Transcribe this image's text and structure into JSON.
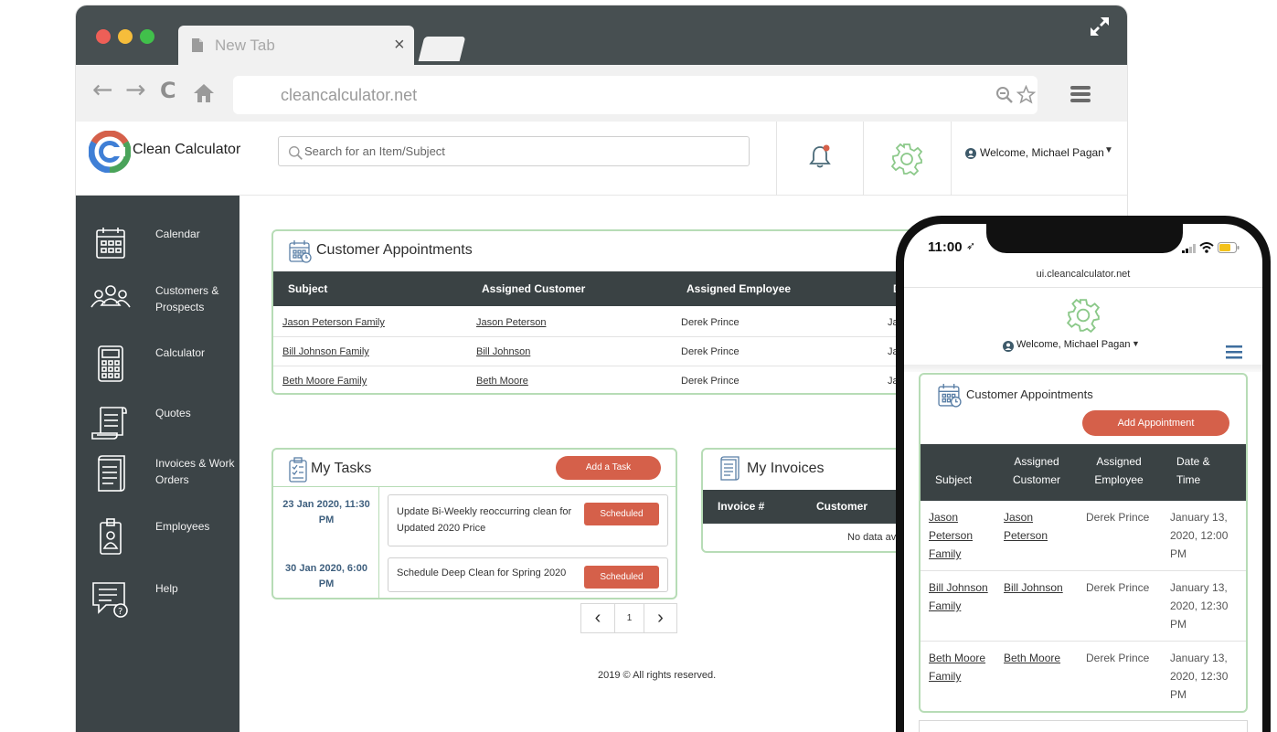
{
  "browser": {
    "tab_title": "New Tab",
    "tab_close": "×",
    "url": "cleancalculator.net"
  },
  "app": {
    "logo_text": "Clean Calculator",
    "search_placeholder": "Search for an Item/Subject",
    "welcome": "Welcome, Michael Pagan",
    "accent_color": "#d5604a",
    "dark_color": "#3c4447",
    "border_color": "#b7dcb6"
  },
  "sidebar": {
    "items": [
      {
        "label": "Calendar",
        "icon": "calendar-icon"
      },
      {
        "label": "Customers & Prospects",
        "icon": "customers-icon"
      },
      {
        "label": "Calculator",
        "icon": "calculator-icon"
      },
      {
        "label": "Quotes",
        "icon": "quotes-icon"
      },
      {
        "label": "Invoices & Work Orders",
        "icon": "invoices-icon"
      },
      {
        "label": "Employees",
        "icon": "employees-icon"
      },
      {
        "label": "Help",
        "icon": "help-icon"
      }
    ]
  },
  "appointments": {
    "title": "Customer Appointments",
    "columns": [
      "Subject",
      "Assigned Customer",
      "Assigned Employee",
      "D"
    ],
    "rows": [
      {
        "subject": "Jason Peterson Family",
        "customer": "Jason Peterson",
        "employee": "Derek Prince",
        "date": "Ja"
      },
      {
        "subject": "Bill Johnson Family",
        "customer": "Bill Johnson",
        "employee": "Derek Prince",
        "date": "Ja"
      },
      {
        "subject": "Beth Moore Family",
        "customer": "Beth Moore",
        "employee": "Derek Prince",
        "date": "Ja"
      }
    ]
  },
  "tasks": {
    "title": "My Tasks",
    "add_label": "Add a Task",
    "items": [
      {
        "date": "23 Jan 2020, 11:30 PM",
        "text": "Update Bi-Weekly reoccurring clean for Updated 2020 Price",
        "status": "Scheduled"
      },
      {
        "date": "30 Jan 2020, 6:00 PM",
        "text": "Schedule Deep Clean for Spring 2020",
        "status": "Scheduled"
      }
    ],
    "pager": {
      "prev": "‹",
      "page": "1",
      "next": "›"
    }
  },
  "invoices": {
    "title": "My Invoices",
    "columns": [
      "Invoice #",
      "Customer"
    ],
    "empty": "No data av"
  },
  "footer": "2019 © All rights reserved.",
  "phone": {
    "time": "11:00",
    "url": "ui.cleancalculator.net",
    "welcome": "Welcome, Michael Pagan",
    "card_title": "Customer Appointments",
    "add_label": "Add Appointment",
    "columns": [
      "Subject",
      "Assigned Customer",
      "Assigned Employee",
      "Date & Time"
    ],
    "rows": [
      {
        "subject": "Jason Peterson Family",
        "customer": "Jason Peterson",
        "employee": "Derek Prince",
        "date": "January 13, 2020, 12:00 PM"
      },
      {
        "subject": "Bill Johnson Family",
        "customer": "Bill Johnson",
        "employee": "Derek Prince",
        "date": "January 13, 2020, 12:30 PM"
      },
      {
        "subject": "Beth Moore Family",
        "customer": "Beth Moore",
        "employee": "Derek Prince",
        "date": "January 13, 2020, 12:30 PM"
      }
    ]
  }
}
